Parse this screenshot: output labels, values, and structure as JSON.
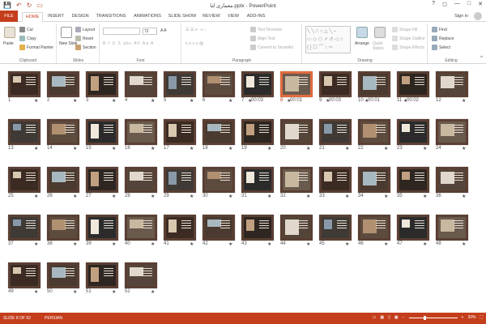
{
  "window": {
    "title": "معماری لنا.pptx - PowerPoint"
  },
  "quick_access": {
    "save": "💾",
    "undo": "↶",
    "redo": "↻",
    "present": "▭"
  },
  "window_controls": {
    "help": "?",
    "restore": "◻",
    "minimize": "—",
    "maximize": "□",
    "close": "✕"
  },
  "tabs": [
    "FILE",
    "HOME",
    "INSERT",
    "DESIGN",
    "TRANSITIONS",
    "ANIMATIONS",
    "SLIDE SHOW",
    "REVIEW",
    "VIEW",
    "ADD-INS"
  ],
  "active_tab": "HOME",
  "signin": "Sign in",
  "ribbon": {
    "clipboard": {
      "label": "Clipboard",
      "paste": "Paste",
      "cut": "Cut",
      "copy": "Copy",
      "format_painter": "Format Painter"
    },
    "slides": {
      "label": "Slides",
      "new_slide": "New Slide",
      "layout": "Layout",
      "reset": "Reset",
      "section": "Section"
    },
    "font": {
      "label": "Font",
      "font_name": "",
      "font_size": "72",
      "buttons": "B I U S abc AV Aa A"
    },
    "paragraph": {
      "label": "Paragraph",
      "text_direction": "Text Direction",
      "align_text": "Align Text",
      "convert": "Convert to SmartArt"
    },
    "drawing": {
      "label": "Drawing",
      "arrange": "Arrange",
      "quick_styles": "Quick Styles",
      "shape_fill": "Shape Fill",
      "shape_outline": "Shape Outline",
      "shape_effects": "Shape Effects"
    },
    "editing": {
      "label": "Editing",
      "find": "Find",
      "replace": "Replace",
      "select": "Select"
    }
  },
  "slides": [
    {
      "n": "1",
      "t": ""
    },
    {
      "n": "2",
      "t": ""
    },
    {
      "n": "3",
      "t": ""
    },
    {
      "n": "4",
      "t": ""
    },
    {
      "n": "5",
      "t": ""
    },
    {
      "n": "6",
      "t": ""
    },
    {
      "n": "7",
      "t": "00:03"
    },
    {
      "n": "8",
      "t": "00:01"
    },
    {
      "n": "9",
      "t": "00:03"
    },
    {
      "n": "10",
      "t": "00:01"
    },
    {
      "n": "11",
      "t": "00:02"
    },
    {
      "n": "12",
      "t": ""
    },
    {
      "n": "13",
      "t": ""
    },
    {
      "n": "14",
      "t": ""
    },
    {
      "n": "15",
      "t": ""
    },
    {
      "n": "16",
      "t": ""
    },
    {
      "n": "17",
      "t": ""
    },
    {
      "n": "18",
      "t": ""
    },
    {
      "n": "19",
      "t": ""
    },
    {
      "n": "20",
      "t": ""
    },
    {
      "n": "21",
      "t": ""
    },
    {
      "n": "22",
      "t": ""
    },
    {
      "n": "23",
      "t": ""
    },
    {
      "n": "24",
      "t": ""
    },
    {
      "n": "25",
      "t": ""
    },
    {
      "n": "26",
      "t": ""
    },
    {
      "n": "27",
      "t": ""
    },
    {
      "n": "28",
      "t": ""
    },
    {
      "n": "29",
      "t": ""
    },
    {
      "n": "30",
      "t": ""
    },
    {
      "n": "31",
      "t": ""
    },
    {
      "n": "32",
      "t": ""
    },
    {
      "n": "33",
      "t": ""
    },
    {
      "n": "34",
      "t": ""
    },
    {
      "n": "35",
      "t": ""
    },
    {
      "n": "36",
      "t": ""
    },
    {
      "n": "37",
      "t": ""
    },
    {
      "n": "38",
      "t": ""
    },
    {
      "n": "39",
      "t": ""
    },
    {
      "n": "40",
      "t": ""
    },
    {
      "n": "41",
      "t": ""
    },
    {
      "n": "42",
      "t": ""
    },
    {
      "n": "43",
      "t": ""
    },
    {
      "n": "44",
      "t": ""
    },
    {
      "n": "45",
      "t": ""
    },
    {
      "n": "46",
      "t": ""
    },
    {
      "n": "47",
      "t": ""
    },
    {
      "n": "48",
      "t": ""
    },
    {
      "n": "49",
      "t": ""
    },
    {
      "n": "50",
      "t": ""
    },
    {
      "n": "51",
      "t": ""
    },
    {
      "n": "52",
      "t": ""
    }
  ],
  "selected_slide": "8",
  "star": "★",
  "status": {
    "slide_info": "SLIDE 8 OF 52",
    "language": "PERSIAN",
    "zoom": "30%"
  },
  "colors": {
    "accent": "#c43e1c",
    "selection": "#e06b3e"
  }
}
